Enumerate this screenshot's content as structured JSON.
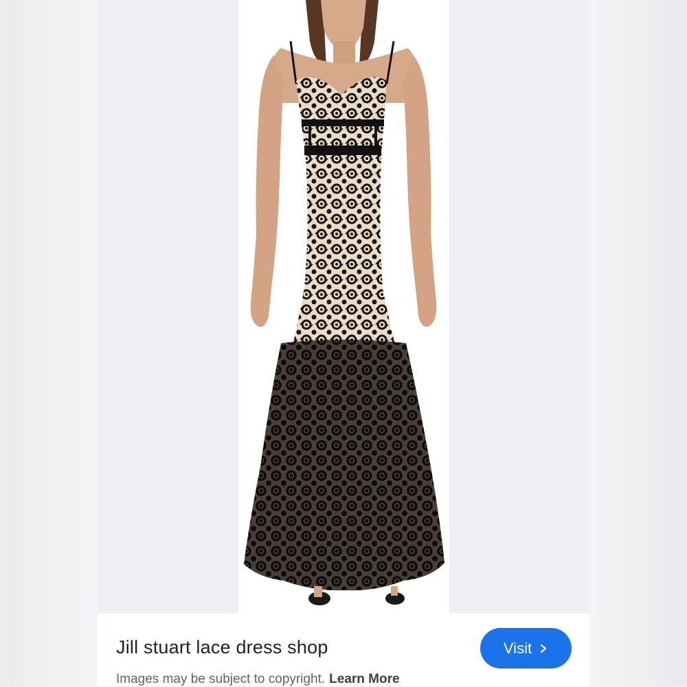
{
  "result": {
    "title": "Jill stuart lace dress shop",
    "visit_label": "Visit",
    "disclaimer": "Images may be subject to copyright.",
    "learn_more": "Learn More"
  },
  "colors": {
    "visit_button": "#1a73e8",
    "title_text": "#202124",
    "disclaimer_text": "#5f6368",
    "lace": "#141414",
    "lining": "#ecdcc6",
    "skin": "#d7a98b",
    "hair": "#5a3522"
  },
  "icons": {
    "visit_chevron": "chevron-right-icon"
  }
}
